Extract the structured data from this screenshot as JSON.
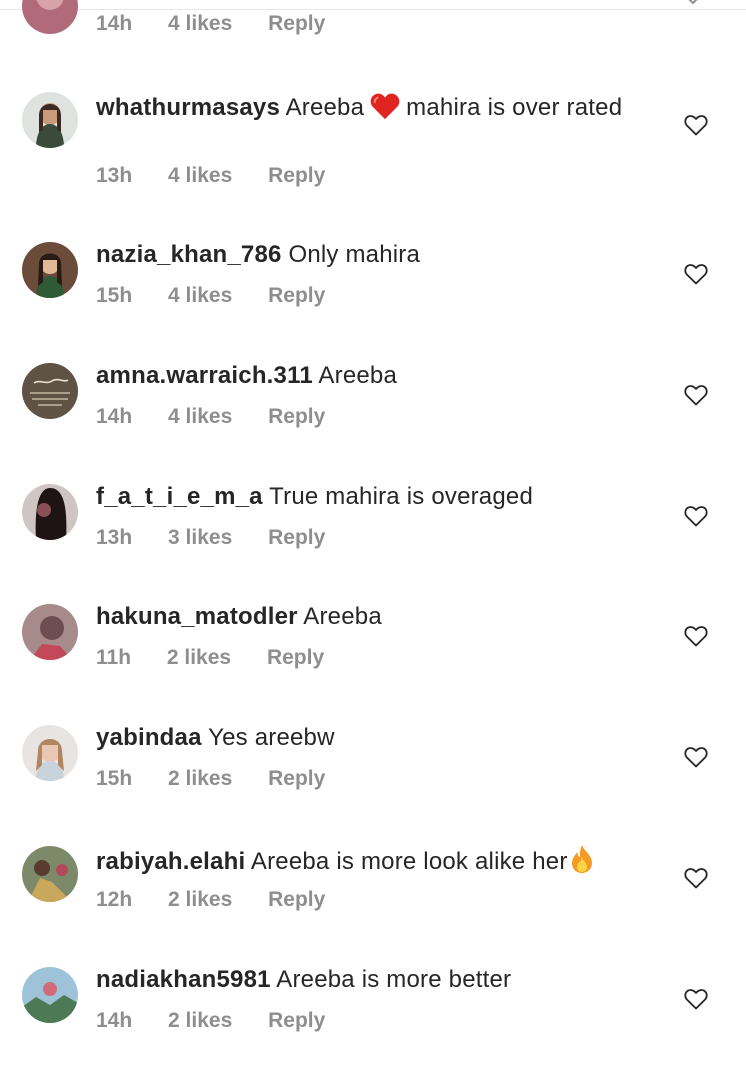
{
  "top": {
    "time": "14h",
    "likes": "4 likes",
    "reply": "Reply"
  },
  "comments": [
    {
      "username": "whathurmasays",
      "text_before": "Areeba",
      "emoji": "heart-emoji",
      "text_after": "mahira is over rated",
      "time": "13h",
      "likes": "4 likes",
      "reply": "Reply"
    },
    {
      "username": "nazia_khan_786",
      "text": "Only mahira",
      "time": "15h",
      "likes": "4 likes",
      "reply": "Reply"
    },
    {
      "username": "amna.warraich.311",
      "text": "Areeba",
      "time": "14h",
      "likes": "4 likes",
      "reply": "Reply"
    },
    {
      "username": "f_a_t_i_e_m_a",
      "text": "True mahira is overaged",
      "time": "13h",
      "likes": "3 likes",
      "reply": "Reply"
    },
    {
      "username": "hakuna_matodler",
      "text": "Areeba",
      "time": "11h",
      "likes": "2 likes",
      "reply": "Reply"
    },
    {
      "username": "yabindaa",
      "text": "Yes areebw",
      "time": "15h",
      "likes": "2 likes",
      "reply": "Reply"
    },
    {
      "username": "rabiyah.elahi",
      "text": "Areeba is more look alike her",
      "emoji": "fire-emoji",
      "time": "12h",
      "likes": "2 likes",
      "reply": "Reply"
    },
    {
      "username": "nadiakhan5981",
      "text": "Areeba is more better",
      "time": "14h",
      "likes": "2 likes",
      "reply": "Reply"
    }
  ],
  "colors": {
    "text": "#262626",
    "meta": "#8e8e8e",
    "heart_emoji": "#e0241f",
    "fire_emoji": "#f59a23"
  }
}
